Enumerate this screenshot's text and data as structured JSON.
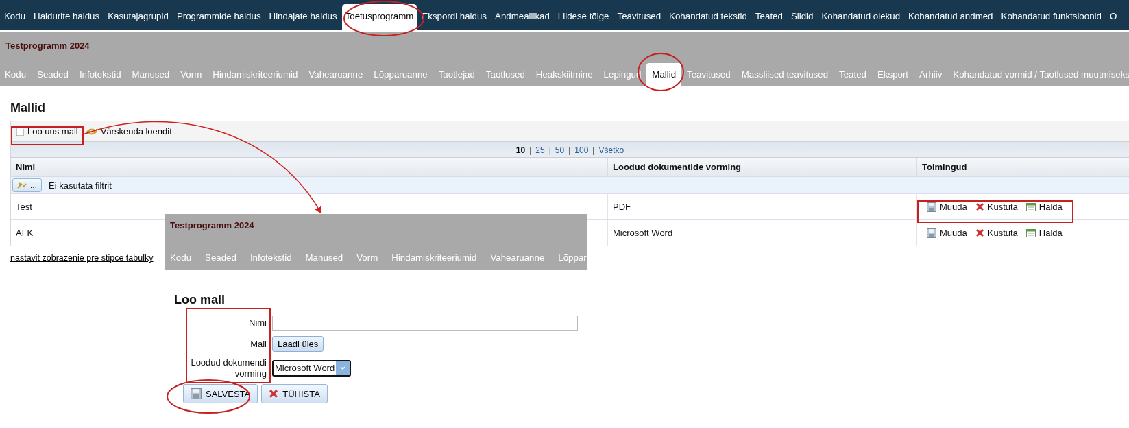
{
  "top_nav": [
    {
      "label": "Kodu",
      "selected": false
    },
    {
      "label": "Haldurite haldus",
      "selected": false
    },
    {
      "label": "Kasutajagrupid",
      "selected": false
    },
    {
      "label": "Programmide haldus",
      "selected": false
    },
    {
      "label": "Hindajate haldus",
      "selected": false
    },
    {
      "label": "Toetusprogramm",
      "selected": true
    },
    {
      "label": "Ekspordi haldus",
      "selected": false
    },
    {
      "label": "Andmeallikad",
      "selected": false
    },
    {
      "label": "Liidese tõlge",
      "selected": false
    },
    {
      "label": "Teavitused",
      "selected": false
    },
    {
      "label": "Kohandatud tekstid",
      "selected": false
    },
    {
      "label": "Teated",
      "selected": false
    },
    {
      "label": "Sildid",
      "selected": false
    },
    {
      "label": "Kohandatud olekud",
      "selected": false
    },
    {
      "label": "Kohandatud andmed",
      "selected": false
    },
    {
      "label": "Kohandatud funktsioonid",
      "selected": false
    },
    {
      "label": "O",
      "selected": false
    }
  ],
  "program": {
    "title": "Testprogramm 2024",
    "tabs": [
      {
        "label": "Kodu",
        "selected": false
      },
      {
        "label": "Seaded",
        "selected": false
      },
      {
        "label": "Infotekstid",
        "selected": false
      },
      {
        "label": "Manused",
        "selected": false
      },
      {
        "label": "Vorm",
        "selected": false
      },
      {
        "label": "Hindamiskriteeriumid",
        "selected": false
      },
      {
        "label": "Vahearuanne",
        "selected": false
      },
      {
        "label": "Lõpparuanne",
        "selected": false
      },
      {
        "label": "Taotlejad",
        "selected": false
      },
      {
        "label": "Taotlused",
        "selected": false
      },
      {
        "label": "Heakskiitmine",
        "selected": false
      },
      {
        "label": "Lepingud",
        "selected": false
      },
      {
        "label": "Mallid",
        "selected": true
      },
      {
        "label": "Teavitused",
        "selected": false
      },
      {
        "label": "Massliised teavitused",
        "selected": false
      },
      {
        "label": "Teated",
        "selected": false
      },
      {
        "label": "Eksport",
        "selected": false
      },
      {
        "label": "Arhiiv",
        "selected": false
      },
      {
        "label": "Kohandatud vormid / Taotlused muutmiseks",
        "selected": false
      }
    ]
  },
  "page_title": "Mallid",
  "toolbar": [
    {
      "kind": "new",
      "label": "Loo uus mall"
    },
    {
      "kind": "refresh",
      "label": "Värskenda loendit"
    }
  ],
  "pager": {
    "separator": "|",
    "pages": [
      {
        "label": "10",
        "selected": true
      },
      {
        "label": "25",
        "selected": false
      },
      {
        "label": "50",
        "selected": false
      },
      {
        "label": "100",
        "selected": false
      },
      {
        "label": "Všetko",
        "selected": false
      }
    ]
  },
  "table": {
    "columns": [
      "Nimi",
      "Loodud dokumentide vorming",
      "Toimingud"
    ],
    "filter": {
      "button": "...",
      "text": "Ei kasutata filtrit"
    },
    "rows": [
      {
        "name": "Test",
        "format": "PDF",
        "actions": [
          {
            "kind": "edit",
            "label": "Muuda"
          },
          {
            "kind": "delete",
            "label": "Kustuta"
          },
          {
            "kind": "manage",
            "label": "Halda"
          }
        ]
      },
      {
        "name": "AFK",
        "format": "Microsoft Word",
        "actions": [
          {
            "kind": "edit",
            "label": "Muuda"
          },
          {
            "kind": "delete",
            "label": "Kustuta"
          },
          {
            "kind": "manage",
            "label": "Halda"
          }
        ]
      }
    ]
  },
  "column_settings_link": "nastavit zobrazenie pre stipce tabulky",
  "inset": {
    "title": "Testprogramm 2024",
    "tabs": [
      "Kodu",
      "Seaded",
      "Infotekstid",
      "Manused",
      "Vorm",
      "Hindamiskriteeriumid",
      "Vahearuanne",
      "Lõppar"
    ]
  },
  "form": {
    "title": "Loo mall",
    "fields": [
      {
        "kind": "text",
        "label": "Nimi"
      },
      {
        "kind": "upload",
        "label": "Mall",
        "button": "Laadi üles"
      },
      {
        "kind": "select",
        "label": "Loodud dokumendi vorming",
        "value": "Microsoft Word"
      }
    ],
    "buttons": [
      {
        "kind": "save",
        "label": "SALVESTA"
      },
      {
        "kind": "cancel",
        "label": "TÜHISTA"
      }
    ]
  }
}
